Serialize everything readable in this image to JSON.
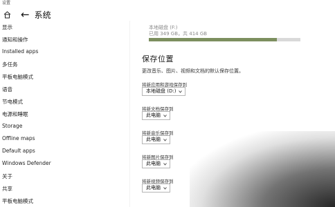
{
  "window": {
    "title": "设置"
  },
  "header": {
    "back_icon": "back-arrow-icon",
    "home_icon": "home-icon",
    "title": "系统"
  },
  "sidebar": {
    "items": [
      {
        "label": "显示"
      },
      {
        "label": "通知和操作"
      },
      {
        "label": "Installed apps"
      },
      {
        "label": "多任务"
      },
      {
        "label": "平板电脑模式"
      },
      {
        "label": "语音"
      },
      {
        "label": "节电模式"
      },
      {
        "label": "电源和睡眠"
      },
      {
        "label": "Storage"
      },
      {
        "label": "Offline maps"
      },
      {
        "label": "Default apps"
      },
      {
        "label": "Windows Defender"
      },
      {
        "label": "关于"
      },
      {
        "label": "共享"
      },
      {
        "label": "平板电脑模式"
      }
    ]
  },
  "main": {
    "drive": {
      "name": "本地磁盘 (F:)",
      "usage": "已用 349 GB，共 414 GB",
      "used_fraction": 0.843,
      "bar_color": "#7c8f5f"
    },
    "section_title": "保存位置",
    "section_desc": "更改音乐、图片、视频和文档的默认保存位置。",
    "settings": [
      {
        "label": "将新应用和游戏保存到",
        "value": "本地磁盘 (D:)"
      },
      {
        "label": "将新文档保存到",
        "value": "此电脑"
      },
      {
        "label": "将新音乐保存到",
        "value": "此电脑"
      },
      {
        "label": "将新图片保存到",
        "value": "此电脑"
      },
      {
        "label": "将新视频保存到",
        "value": "此电脑"
      }
    ]
  }
}
